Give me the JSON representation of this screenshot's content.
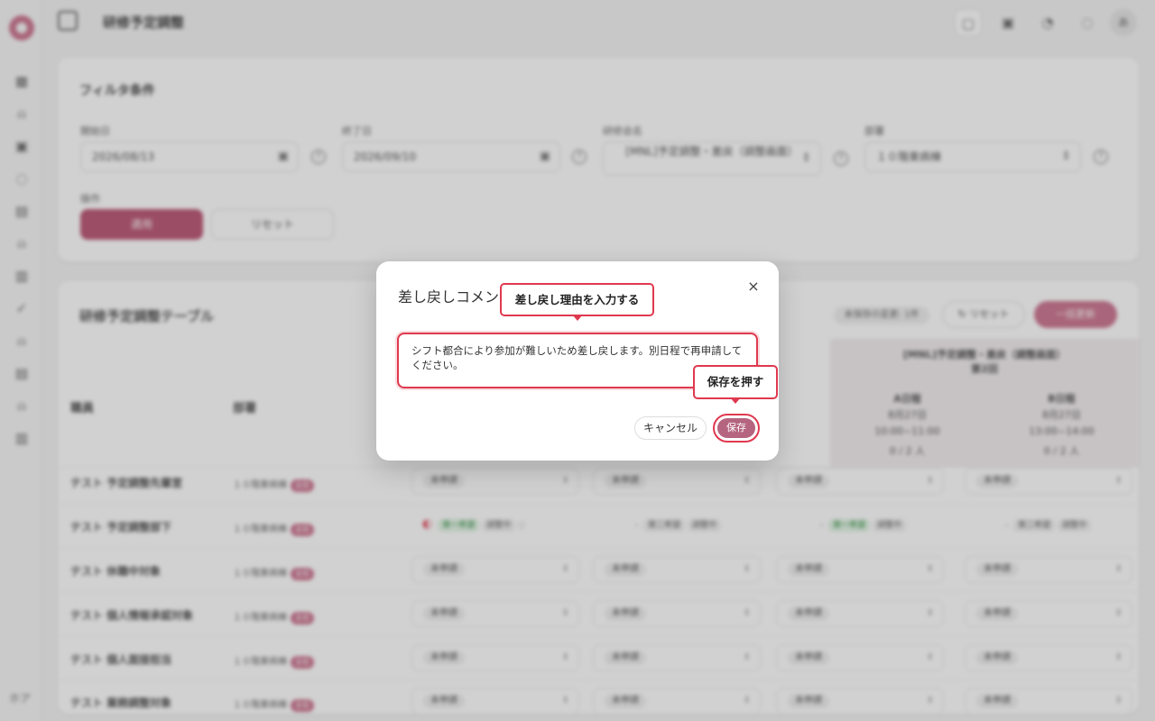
{
  "app": {
    "page_title": "研修予定調整",
    "user_avatar": "あ",
    "sidebar_footer": "ホア"
  },
  "filter": {
    "title": "フィルタ条件",
    "start_label": "開始日",
    "start_value": "2026/08/13",
    "end_label": "終了日",
    "end_value": "2026/09/10",
    "course_label": "研修会名",
    "course_value": "[MNL]予定調整・差戻（調整画面）",
    "dept_label": "部署",
    "dept_value": "１０階東病棟",
    "ops_label": "操作",
    "apply_label": "適用",
    "reset_label": "リセット"
  },
  "table": {
    "title": "研修予定調整テーブル",
    "pending_badge": "未保存の変更: 1件",
    "reset_label": "リセット",
    "bulk_label": "一括更新",
    "col_staff": "職員",
    "col_dept": "部署",
    "session_title": "[MNL]予定調整・差戻（調整画面）",
    "session_round": "第2回",
    "session_a_name": "A日程",
    "session_a_date": "8月27日",
    "session_a_time": "10:00~11:00",
    "session_a_count": "0 / 2 人",
    "session_b_name": "B日程",
    "session_b_date": "8月27日",
    "session_b_time": "13:00~14:00",
    "session_b_count": "0 / 2 人",
    "status_unapplied": "未申請",
    "status_first": "第一希望",
    "status_second": "第二希望",
    "status_review": "調整中",
    "rows": [
      {
        "name": "テスト 予定調整先輩室",
        "dept": "１０階東病棟",
        "tag": "主任"
      },
      {
        "name": "テスト 予定調整部下",
        "dept": "１０階東病棟",
        "tag": "主任"
      },
      {
        "name": "テスト 休職中対象",
        "dept": "１０階東病棟",
        "tag": "主任"
      },
      {
        "name": "テスト 個人情報承認対象",
        "dept": "１０階東病棟",
        "tag": "主任"
      },
      {
        "name": "テスト 個人面接担当",
        "dept": "１０階東病棟",
        "tag": "主任"
      },
      {
        "name": "テスト 業務調整対象",
        "dept": "１０階東病棟",
        "tag": "主任"
      }
    ]
  },
  "dialog": {
    "title": "差し戻しコメント",
    "comment": "シフト都合により参加が難しいため差し戻します。別日程で再申請してください。",
    "cancel_label": "キャンセル",
    "save_label": "保存",
    "close_glyph": "×"
  },
  "callouts": {
    "enter_reason": "差し戻し理由を入力する",
    "press_save": "保存を押す"
  },
  "colors": {
    "brand": "#b5486a",
    "highlight": "#e0394f"
  }
}
